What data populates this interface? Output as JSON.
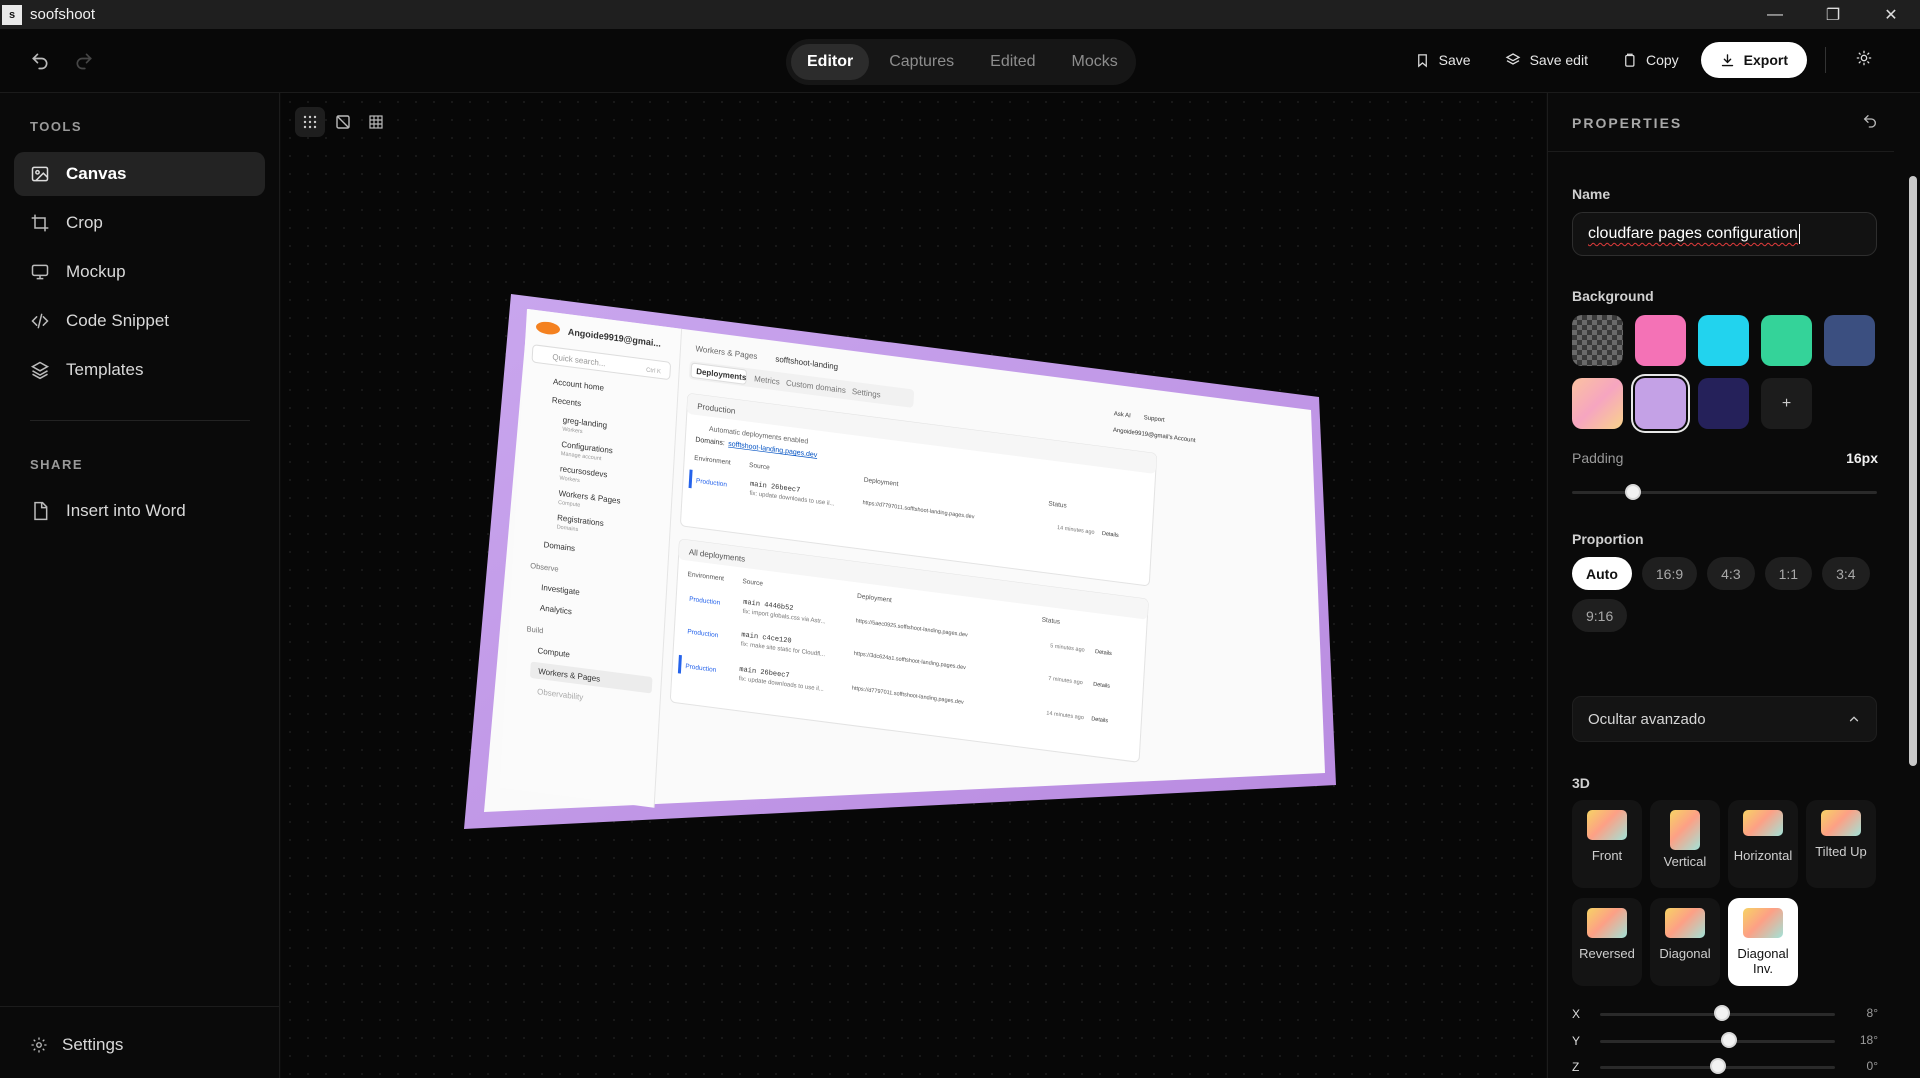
{
  "window": {
    "title": "soofshoot",
    "icon_letter": "s"
  },
  "topbar": {
    "modes": [
      "Editor",
      "Captures",
      "Edited",
      "Mocks"
    ],
    "active_mode": "Editor",
    "save_label": "Save",
    "save_edit_label": "Save edit",
    "copy_label": "Copy",
    "export_label": "Export"
  },
  "sidebar": {
    "tools_heading": "TOOLS",
    "tools": [
      {
        "label": "Canvas",
        "icon": "image-icon",
        "active": true
      },
      {
        "label": "Crop",
        "icon": "crop-icon"
      },
      {
        "label": "Mockup",
        "icon": "monitor-icon"
      },
      {
        "label": "Code Snippet",
        "icon": "code-icon"
      },
      {
        "label": "Templates",
        "icon": "layers-icon"
      }
    ],
    "share_heading": "SHARE",
    "share_items": [
      {
        "label": "Insert into Word",
        "icon": "document-icon"
      }
    ],
    "settings_label": "Settings"
  },
  "mockup": {
    "account": "Angoide9919@gmai...",
    "search_placeholder": "Quick search...",
    "search_shortcut": "Ctrl K",
    "breadcrumb_section": "Workers & Pages",
    "breadcrumb_project": "sofftshoot-landing",
    "tabs": [
      "Deployments",
      "Metrics",
      "Custom domains",
      "Settings"
    ],
    "top_right": [
      "Ask AI",
      "Support"
    ],
    "account_right": "Angoide9919@gmail's Account",
    "nav": [
      {
        "label": "Account home"
      },
      {
        "label": "Recents"
      },
      {
        "label": "greg-landing",
        "sub": "Workers"
      },
      {
        "label": "Configurations",
        "sub": "Manage account"
      },
      {
        "label": "recursosdevs",
        "sub": "Workers"
      },
      {
        "label": "Workers & Pages",
        "sub": "Compute"
      },
      {
        "label": "Registrations",
        "sub": "Domains"
      },
      {
        "label": "Domains"
      },
      {
        "label": "Observe"
      },
      {
        "label": "Investigate"
      },
      {
        "label": "Analytics"
      },
      {
        "label": "Build"
      },
      {
        "label": "Compute"
      },
      {
        "label": "Workers & Pages"
      },
      {
        "label": "Observability"
      }
    ],
    "production_heading": "Production",
    "auto_deploy": "Automatic deployments enabled",
    "domains_label": "Domains:",
    "domain_link": "sofftshoot-landing.pages.dev",
    "columns": [
      "Environment",
      "Source",
      "Deployment",
      "Status"
    ],
    "prod_row": {
      "env": "Production",
      "branch": "main 26beec7",
      "msg": "fix: update downloads to use il...",
      "url": "https://d7797011.sofftshoot-landing.pages.dev",
      "status": "14 minutes ago",
      "details": "Details"
    },
    "all_heading": "All deployments",
    "rows": [
      {
        "env": "Production",
        "branch": "main 4446b52",
        "msg": "fix: import globals.css via Astr...",
        "url": "https://5aec0925.sofftshoot-landing.pages.dev",
        "status": "5 minutes ago",
        "details": "Details"
      },
      {
        "env": "Production",
        "branch": "main c4ce120",
        "msg": "fix: make site static for Cloudfl...",
        "url": "https://3dc624a1.sofftshoot-landing.pages.dev",
        "status": "7 minutes ago",
        "details": "Details"
      },
      {
        "env": "Production",
        "branch": "main 26beec7",
        "msg": "fix: update downloads to use il...",
        "url": "https://d7797011.sofftshoot-landing.pages.dev",
        "status": "14 minutes ago",
        "details": "Details"
      }
    ]
  },
  "properties": {
    "heading": "PROPERTIES",
    "name_label": "Name",
    "name_value": "cloudfare pages configuration",
    "background_label": "Background",
    "background_swatches": [
      "transparent",
      "#f472b6",
      "#22d3ee",
      "#34d399",
      "#3b4f80",
      "peach-gradient",
      "#c4a1e6",
      "#25215a"
    ],
    "selected_swatch": 6,
    "add_swatch": "+",
    "padding_label": "Padding",
    "padding_value": "16px",
    "padding_fraction": 0.2,
    "proportion_label": "Proportion",
    "proportions": [
      "Auto",
      "16:9",
      "4:3",
      "1:1",
      "3:4",
      "9:16"
    ],
    "active_proportion": "Auto",
    "advanced_label": "Ocultar avanzado",
    "threed_label": "3D",
    "presets": [
      "Front",
      "Vertical",
      "Horizontal",
      "Tilted Up",
      "Reversed",
      "Diagonal",
      "Diagonal Inv."
    ],
    "active_preset": "Diagonal Inv.",
    "rotation": [
      {
        "axis": "X",
        "value": "8°",
        "fraction": 0.52
      },
      {
        "axis": "Y",
        "value": "18°",
        "fraction": 0.55
      },
      {
        "axis": "Z",
        "value": "0°",
        "fraction": 0.5
      }
    ]
  }
}
